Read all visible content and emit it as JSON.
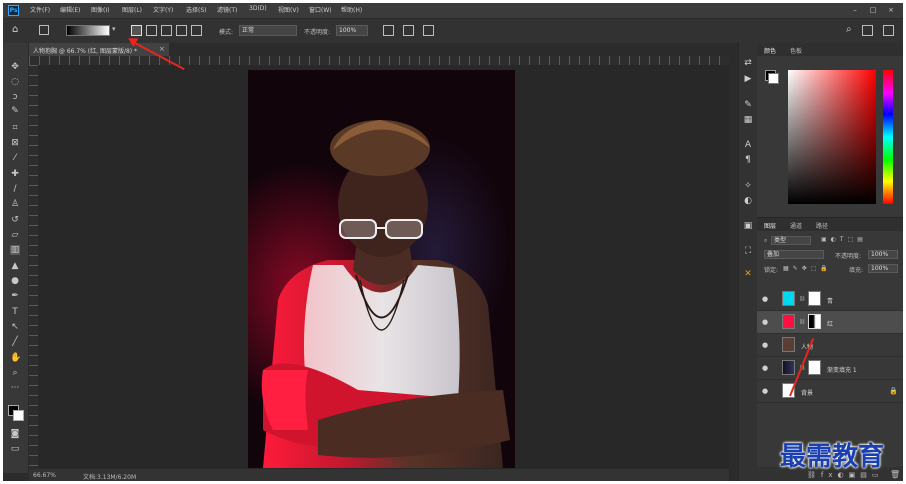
{
  "menubar": {
    "items": [
      "文件(F)",
      "编辑(E)",
      "图像(I)",
      "图层(L)",
      "文字(Y)",
      "选择(S)",
      "滤镜(T)",
      "3D(D)",
      "视图(V)",
      "窗口(W)",
      "帮助(H)"
    ]
  },
  "optionsbar": {
    "mode_label": "模式:",
    "mode_value": "正常",
    "opacity_label": "不透明度:",
    "opacity_value": "100%"
  },
  "document": {
    "tab_label": "人物抱胸 @ 66.7% (红, 图层蒙版/8) *"
  },
  "status": {
    "zoom": "66.67%",
    "doc_size": "文档:3.13M/6.20M"
  },
  "panels": {
    "color_tabs": [
      "颜色",
      "色板"
    ],
    "layers_tabs": [
      "图层",
      "通道",
      "路径"
    ],
    "kind_label": "类型",
    "blend_value": "叠加",
    "opacity_label": "不透明度:",
    "opacity_value": "100%",
    "lock_label": "锁定:",
    "fill_label": "填充:",
    "fill_value": "100%",
    "layers": [
      {
        "name": "青",
        "thumb_color": "#00d8f0",
        "mask_color": "#ffffff",
        "selected": false
      },
      {
        "name": "红",
        "thumb_color": "#ff1040",
        "mask_color": "#ffffff",
        "selected": true
      },
      {
        "name": "人物",
        "thumb_color": "#5a3d35",
        "mask_color": "",
        "selected": false
      },
      {
        "name": "渐变填充 1",
        "thumb_color": "#22224a",
        "mask_color": "#ffffff",
        "selected": false
      },
      {
        "name": "背景",
        "thumb_color": "#ffffff",
        "mask_color": "",
        "selected": false
      }
    ]
  },
  "watermark": {
    "text": "最需教育"
  },
  "icons": {
    "home": "home-icon",
    "search": "search-icon",
    "eye": "eye-icon",
    "lock": "lock-icon",
    "trash": "trash-icon"
  },
  "colors": {
    "accent_red": "#e8261f",
    "watermark_blue": "#1a3fb0",
    "ps_blue": "#31a8ff"
  }
}
